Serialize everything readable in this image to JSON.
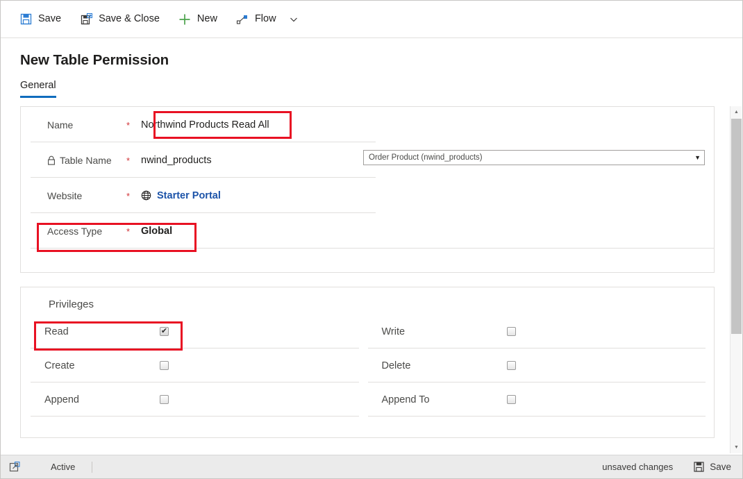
{
  "commandbar": {
    "items": [
      {
        "label": "Save",
        "icon": "save-icon"
      },
      {
        "label": "Save & Close",
        "icon": "save-close-icon"
      },
      {
        "label": "New",
        "icon": "plus-icon"
      },
      {
        "label": "Flow",
        "icon": "flow-icon"
      }
    ]
  },
  "header": {
    "title": "New Table Permission",
    "tabs": [
      {
        "label": "General",
        "active": true
      }
    ]
  },
  "general": {
    "rows": [
      {
        "label": "Name",
        "required": "*",
        "value": "Northwind Products Read All",
        "locked": false
      },
      {
        "label": "Table Name",
        "required": "*",
        "value": "nwind_products",
        "locked": true
      },
      {
        "label": "Website",
        "required": "*",
        "value": "Starter Portal",
        "link": true
      },
      {
        "label": "Access Type",
        "required": "*",
        "value": "Global",
        "bold": true
      }
    ],
    "lookup": {
      "value": "Order Product (nwind_products)",
      "arrow": "▼"
    }
  },
  "privileges": {
    "title": "Privileges",
    "left": [
      {
        "label": "Read",
        "checked": true
      },
      {
        "label": "Create",
        "checked": false
      },
      {
        "label": "Append",
        "checked": false
      }
    ],
    "right": [
      {
        "label": "Write",
        "checked": false
      },
      {
        "label": "Delete",
        "checked": false
      },
      {
        "label": "Append To",
        "checked": false
      }
    ],
    "check_glyph": "✔"
  },
  "statusbar": {
    "popout_icon": "popout-icon",
    "state": "Active",
    "unsaved": "unsaved changes",
    "save_label": "Save"
  },
  "colors": {
    "accent": "#0f6cbd",
    "link": "#1c53a8",
    "required": "#d13438",
    "annotation": "#e81123",
    "new_green": "#4ba24b"
  }
}
